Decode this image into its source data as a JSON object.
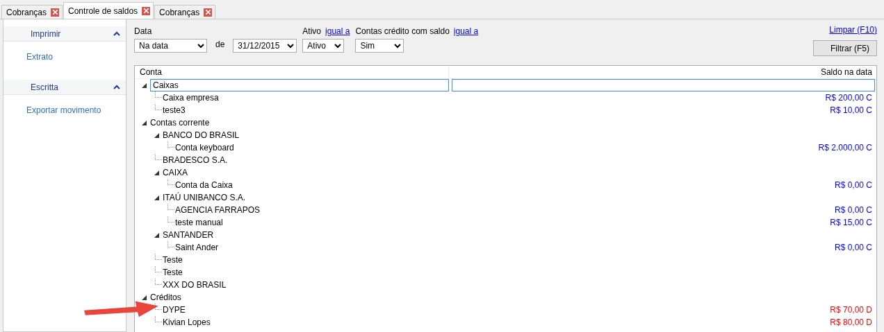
{
  "tabs": [
    {
      "label": "Cobranças",
      "selected": false
    },
    {
      "label": "Controle de saldos",
      "selected": true
    },
    {
      "label": "Cobranças",
      "selected": false
    }
  ],
  "sidebar": {
    "sections": [
      {
        "title": "Imprimir",
        "expanded": true,
        "items": [
          "Extrato"
        ]
      },
      {
        "title": "Escritta",
        "expanded": true,
        "items": [
          "Exportar movimento"
        ]
      }
    ]
  },
  "filters": {
    "date_label": "Data",
    "date_mode": "Na data",
    "de_label": "de",
    "date": "31/12/2015",
    "ativo_label": "Ativo",
    "ativo_link": "igual a",
    "ativo": "Ativo",
    "credito_label": "Contas crédito com saldo",
    "credito_link": "igual a",
    "credito": "Sim",
    "clear_link": "Limpar (F10)",
    "filter_button": "Filtrar (F5)"
  },
  "table": {
    "columns": [
      "Conta",
      "Saldo na data"
    ],
    "rows": [
      {
        "name": "Caixas",
        "expanded": true,
        "editing": true,
        "children": [
          {
            "name": "Caixa empresa",
            "balance": "R$ 200,00 C",
            "color": "#0000ff"
          },
          {
            "name": "teste3",
            "balance": "R$ 10,00 C",
            "color": "#0000ff"
          }
        ]
      },
      {
        "name": "Contas corrente",
        "expanded": true,
        "children": [
          {
            "name": "BANCO DO BRASIL",
            "expanded": true,
            "children": [
              {
                "name": "Conta keyboard",
                "balance": "R$ 2.000,00 C",
                "color": "#0000ff"
              }
            ]
          },
          {
            "name": "BRADESCO S.A."
          },
          {
            "name": "CAIXA",
            "expanded": true,
            "children": [
              {
                "name": "Conta da Caixa",
                "balance": "R$ 0,00 C",
                "color": "#0000ff"
              }
            ]
          },
          {
            "name": "ITAÚ UNIBANCO S.A.",
            "expanded": true,
            "children": [
              {
                "name": "AGENCIA FARRAPOS",
                "balance": "R$ 0,00 C",
                "color": "#0000ff"
              },
              {
                "name": "teste manual",
                "balance": "R$ 15,00 C",
                "color": "#0000ff"
              }
            ]
          },
          {
            "name": "SANTANDER",
            "expanded": true,
            "children": [
              {
                "name": "Saint Ander",
                "balance": "R$ 0,00 C",
                "color": "#0000ff"
              }
            ]
          },
          {
            "name": "Teste"
          },
          {
            "name": "Teste"
          },
          {
            "name": "XXX DO BRASIL"
          }
        ]
      },
      {
        "name": "Créditos",
        "expanded": true,
        "children": [
          {
            "name": "DYPE",
            "balance": "R$ 70,00 D",
            "color": "#ff0000"
          },
          {
            "name": "Kivian Lopes",
            "balance": "R$ 80,00 D",
            "color": "#ff0000"
          }
        ]
      }
    ]
  },
  "annotation": {
    "kind": "arrow"
  }
}
